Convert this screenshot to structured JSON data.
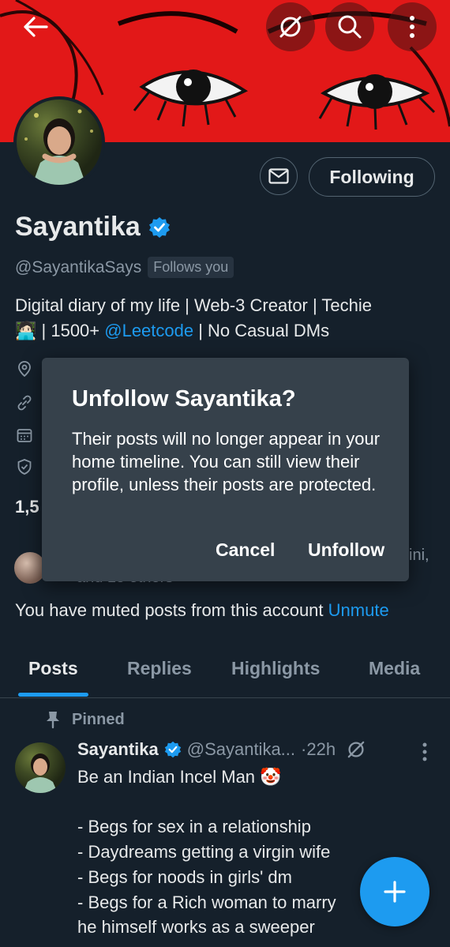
{
  "header": {
    "back_icon": "arrow-left-icon",
    "icons": [
      "grok-icon",
      "search-icon",
      "more-vertical-icon"
    ]
  },
  "profile": {
    "name": "Sayantika",
    "handle": "@SayantikaSays",
    "follows_you": "Follows you",
    "following_label": "Following",
    "bio_part1": "Digital diary of my life | Web-3 Creator | Techie",
    "bio_part2": " | 1500+ ",
    "bio_link": "@Leetcode",
    "bio_part3": " | No Casual DMs",
    "stats_partial": "1,5",
    "followers_text": "and 15 others",
    "followers_right": "ini,"
  },
  "muted": {
    "text": "You have muted posts from this account ",
    "link": "Unmute"
  },
  "tabs": [
    {
      "label": "Posts",
      "active": true
    },
    {
      "label": "Replies",
      "active": false
    },
    {
      "label": "Highlights",
      "active": false
    },
    {
      "label": "Media",
      "active": false
    }
  ],
  "post": {
    "pinned_label": "Pinned",
    "author": "Sayantika",
    "handle": "@Sayantika...",
    "time": "·22h",
    "text": "Be an Indian Incel Man 🤡\n\n- Begs for sex in a relationship\n- Daydreams getting a virgin wife\n- Begs for noods in girls' dm\n- Begs for a Rich woman to marry\nhe himself works as a sweeper"
  },
  "dialog": {
    "title": "Unfollow Sayantika?",
    "body": "Their posts will no longer appear in your home timeline. You can still view their profile, unless their posts are protected.",
    "cancel": "Cancel",
    "confirm": "Unfollow"
  },
  "colors": {
    "background": "#15202b",
    "accent": "#1d9bf0",
    "banner": "#e21818",
    "dialog": "#36414b"
  }
}
